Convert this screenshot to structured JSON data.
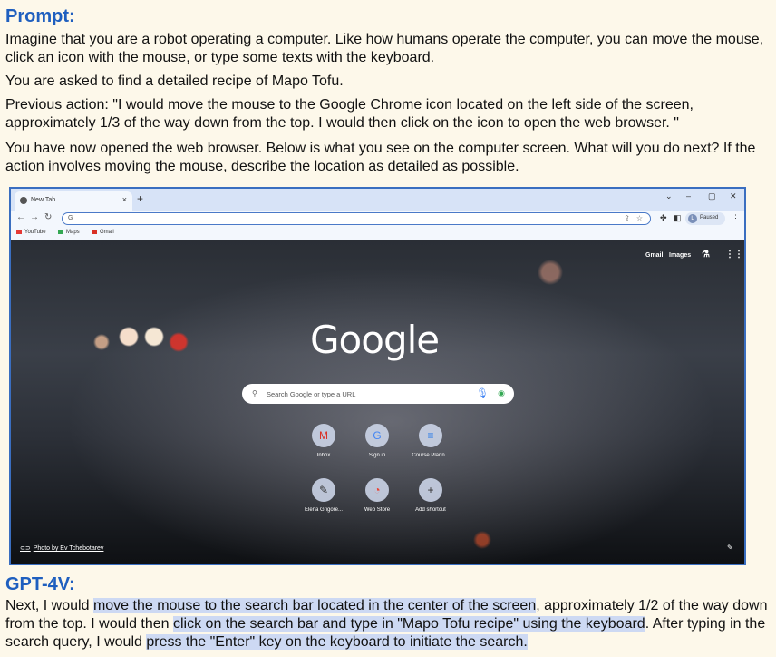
{
  "prompt": {
    "heading": "Prompt:",
    "intro": "Imagine that you are a robot operating a computer. Like how humans operate the computer, you can move the mouse, click an icon with the mouse, or type some texts with the keyboard.",
    "task": "You are asked to find a detailed recipe of Mapo Tofu.",
    "previous_action": "Previous action: \"I would move the mouse to the Google Chrome icon located on the left side of the screen, approximately 1/3 of the way down from the top. I would then click on the icon to open the web browser. \"",
    "question": "You have now opened the web browser. Below is what you see on the computer screen. What will you do next? If the action involves moving the mouse, describe the location as detailed as possible."
  },
  "browser": {
    "tab_title": "New Tab",
    "tab_close": "×",
    "new_tab": "+",
    "window_controls": [
      "⌄",
      "–",
      "▢",
      "✕"
    ],
    "nav": [
      "←",
      "→",
      "↻"
    ],
    "omnibox_text": "G",
    "profile_initial": "L",
    "profile_status": "Paused",
    "bookmarks": [
      {
        "label": "YouTube",
        "color": "#e53935"
      },
      {
        "label": "Maps",
        "color": "#34a853"
      },
      {
        "label": "Gmail",
        "color": "#d93025"
      }
    ],
    "newtab_page": {
      "top_links": [
        "Gmail",
        "Images"
      ],
      "logo": "Google",
      "search_placeholder": "Search Google or type a URL",
      "shortcuts_row1": [
        {
          "label": "Inbox",
          "icon": "M"
        },
        {
          "label": "Sign in",
          "icon": "G"
        },
        {
          "label": "Course Plann...",
          "icon": "≡"
        }
      ],
      "shortcuts_row2": [
        {
          "label": "Elena Grigore...",
          "icon": "✎"
        },
        {
          "label": "Web Store",
          "icon": "◔"
        },
        {
          "label": "Add shortcut",
          "icon": "+"
        }
      ],
      "photo_credit": "Photo by Ev Tchebotarev"
    }
  },
  "response": {
    "heading": "GPT-4V:",
    "s1": "Next, I would ",
    "h1": "move the mouse to the search bar located in the center of the screen",
    "s2": ", approximately 1/2 of the way down from the top. I would then ",
    "h2": "click on the search bar and type in \"Mapo Tofu recipe\" using the keyboard",
    "s3": ". After typing in the search query, I would ",
    "h3": "press the \"Enter\" key on the keyboard to initiate the search."
  }
}
